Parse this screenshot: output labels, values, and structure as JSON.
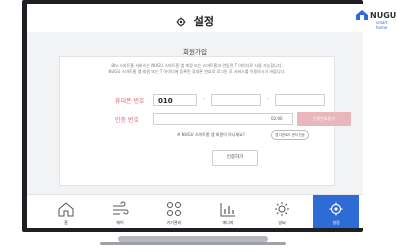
{
  "header": {
    "title": "설정"
  },
  "page": {
    "subtitle": "회원가입",
    "notice_line1": "Btv 스마트홈 서비스는 NUGU 스마트홈 앱 계정 또는 스마트홈과 연동된 T 아이디로 사용 가능합니다.",
    "notice_line2": "NUGU 스마트홈 앱 회원 또는 T 아이디에 등록된 휴대폰 번호로 로그인 후 서비스를 이용하시기 바랍니다."
  },
  "form": {
    "phone_label": "휴대폰 번호",
    "phone_prefix": "010",
    "phone_dash": "-",
    "code_label": "인증 번호",
    "timer": "02:00",
    "resend_button": "인증번호받기",
    "member_question": "※ NUGU 스마트홈 앱 회원이 아니세요?",
    "member_link": "앱 다운로드 문자 전송",
    "auth_button": "인증하기"
  },
  "nav": {
    "items": [
      {
        "label": "홈",
        "icon": "home-icon"
      },
      {
        "label": "에어",
        "icon": "air-icon"
      },
      {
        "label": "기기관리",
        "icon": "device-icon"
      },
      {
        "label": "에너지",
        "icon": "energy-icon"
      },
      {
        "label": "날씨",
        "icon": "weather-icon"
      },
      {
        "label": "설정",
        "icon": "settings-icon",
        "active": true
      }
    ]
  },
  "brand": {
    "name": "NUGU",
    "sub": "smart home"
  },
  "colors": {
    "accent": "#2f6bd6",
    "label": "#e26b7a",
    "disabled_button": "#e8b6bc"
  }
}
